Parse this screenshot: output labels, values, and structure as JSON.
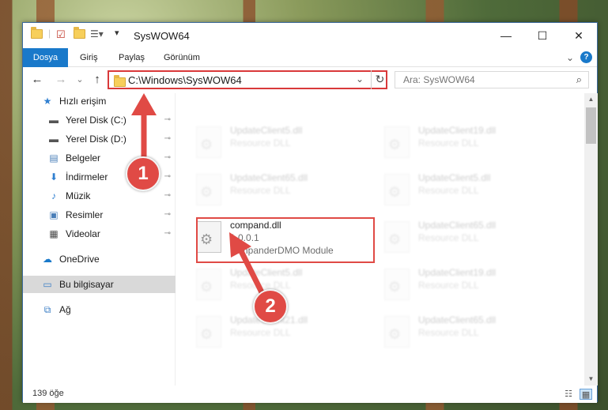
{
  "window": {
    "title": "SysWOW64",
    "minimize_glyph": "—",
    "maximize_glyph": "☐",
    "close_glyph": "✕"
  },
  "ribbon": {
    "tabs": [
      {
        "label": "Dosya"
      },
      {
        "label": "Giriş"
      },
      {
        "label": "Paylaş"
      },
      {
        "label": "Görünüm"
      }
    ],
    "expand_glyph": "⌄",
    "help_glyph": "?"
  },
  "nav": {
    "back_glyph": "←",
    "forward_glyph": "→",
    "recent_glyph": "⌄",
    "up_glyph": "↑",
    "address_path": "C:\\Windows\\SysWOW64",
    "address_dropdown_glyph": "⌄",
    "refresh_glyph": "↻",
    "search_placeholder": "Ara: SysWOW64",
    "search_icon_glyph": "⌕"
  },
  "sidebar": {
    "items": [
      {
        "label": "Hızlı erişim",
        "icon": "star-icon",
        "glyph": "★",
        "color": "#2f7fd0",
        "pinned": false,
        "indent": 0
      },
      {
        "label": "Yerel Disk (C:)",
        "icon": "drive-icon",
        "glyph": "▬",
        "color": "#555555",
        "pinned": true,
        "indent": 1
      },
      {
        "label": "Yerel Disk (D:)",
        "icon": "drive-icon",
        "glyph": "▬",
        "color": "#555555",
        "pinned": true,
        "indent": 1
      },
      {
        "label": "Belgeler",
        "icon": "documents-icon",
        "glyph": "▤",
        "color": "#4a7fb8",
        "pinned": true,
        "indent": 1
      },
      {
        "label": "İndirmeler",
        "icon": "download-icon",
        "glyph": "⬇",
        "color": "#2f7fd0",
        "pinned": true,
        "indent": 1
      },
      {
        "label": "Müzik",
        "icon": "music-icon",
        "glyph": "♪",
        "color": "#2f7fd0",
        "pinned": true,
        "indent": 1
      },
      {
        "label": "Resimler",
        "icon": "pictures-icon",
        "glyph": "▣",
        "color": "#4a7fb8",
        "pinned": true,
        "indent": 1
      },
      {
        "label": "Videolar",
        "icon": "videos-icon",
        "glyph": "▦",
        "color": "#4a4a4a",
        "pinned": true,
        "indent": 1
      },
      {
        "label": "OneDrive",
        "icon": "cloud-icon",
        "glyph": "☁",
        "color": "#1979ca",
        "pinned": false,
        "indent": 0
      },
      {
        "label": "Bu bilgisayar",
        "icon": "computer-icon",
        "glyph": "▭",
        "color": "#3b7ec5",
        "pinned": false,
        "indent": 0,
        "selected": true
      },
      {
        "label": "Ağ",
        "icon": "network-icon",
        "glyph": "⧉",
        "color": "#3b7ec5",
        "pinned": false,
        "indent": 0
      }
    ],
    "pin_glyph": "📌"
  },
  "files": [
    {
      "name": "UpdateClient5.dll",
      "sub": "Resource DLL",
      "faded": true
    },
    {
      "name": "UpdateClient19.dll",
      "sub": "Resource DLL",
      "faded": true
    },
    {
      "name": "UpdateClient65.dll",
      "sub": "Resource DLL",
      "faded": true
    },
    {
      "name": "UpdateClient5.dll",
      "sub": "Resource DLL",
      "faded": true
    },
    {
      "name": "compand.dll",
      "version": "1.0.0.1",
      "sub": "companderDMO Module",
      "faded": false
    },
    {
      "name": "UpdateClient65.dll",
      "sub": "Resource DLL",
      "faded": true
    },
    {
      "name": "UpdateClient5.dll",
      "sub": "Resource DLL",
      "faded": true
    },
    {
      "name": "UpdateClient19.dll",
      "sub": "Resource DLL",
      "faded": true
    },
    {
      "name": "UpdateClient21.dll",
      "sub": "Resource DLL",
      "faded": true
    },
    {
      "name": "UpdateClient65.dll",
      "sub": "Resource DLL",
      "faded": true
    }
  ],
  "status": {
    "item_count": "139 öğe",
    "details_view_glyph": "☷",
    "tiles_view_glyph": "▦"
  },
  "annotations": {
    "step1": "1",
    "step2": "2",
    "color": "#e04a45"
  }
}
